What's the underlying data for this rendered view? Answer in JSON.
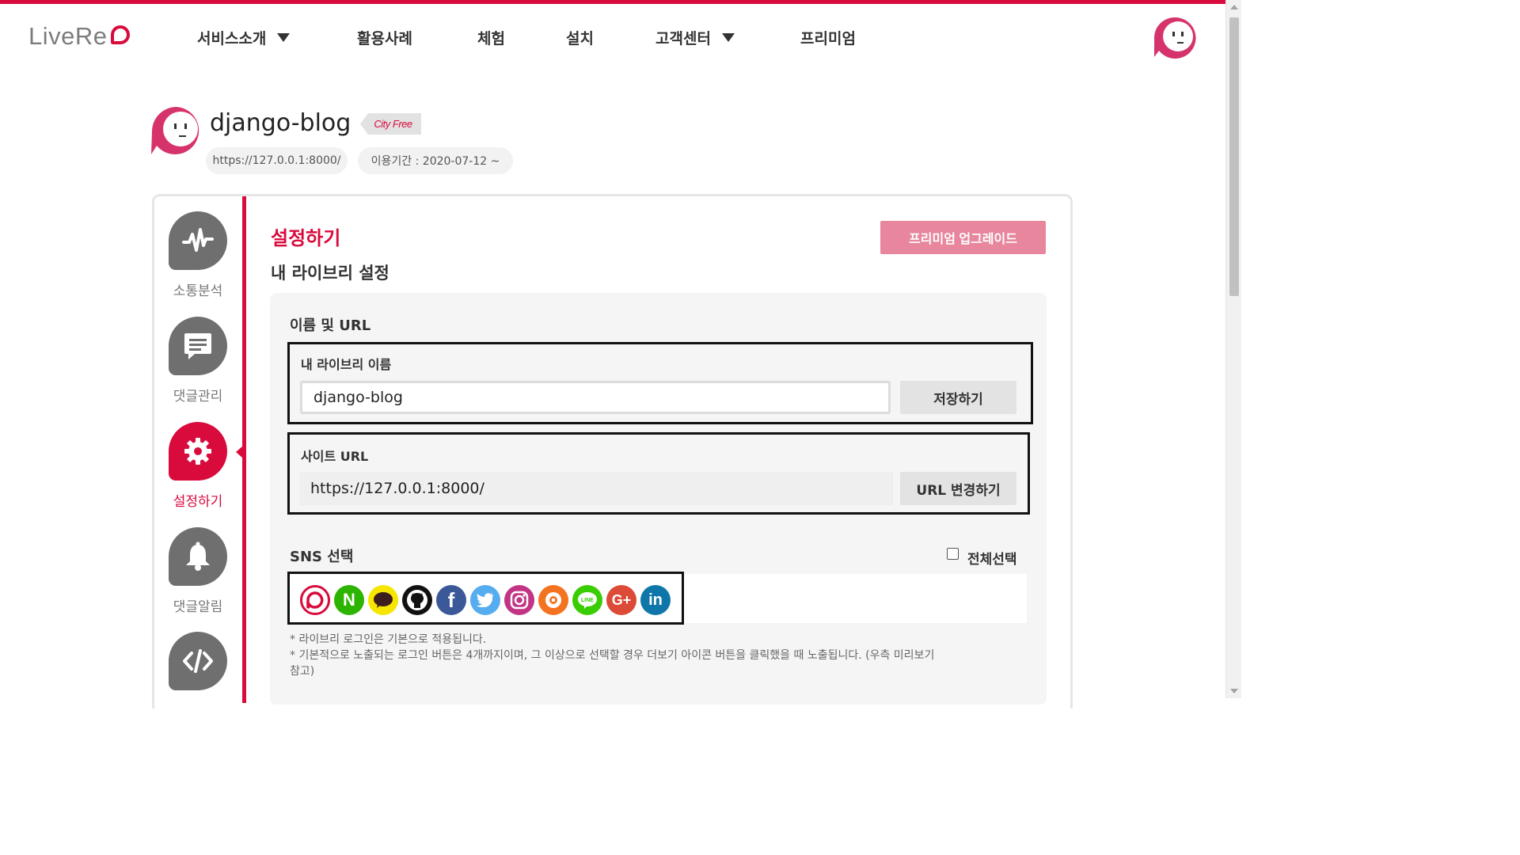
{
  "brand": {
    "logo_text": "LiveRe",
    "accent": "#d90a3c"
  },
  "nav": {
    "items": [
      {
        "label": "서비스소개",
        "dropdown": true
      },
      {
        "label": "활용사례",
        "dropdown": false
      },
      {
        "label": "체험",
        "dropdown": false
      },
      {
        "label": "설치",
        "dropdown": false
      },
      {
        "label": "고객센터",
        "dropdown": true
      },
      {
        "label": "프리미엄",
        "dropdown": false
      }
    ]
  },
  "project": {
    "name": "django-blog",
    "plan_badge": "City Free",
    "url": "https://127.0.0.1:8000/",
    "period": "이용기간 : 2020-07-12 ~"
  },
  "sidebar": {
    "items": [
      {
        "label": "소통분석",
        "icon": "pulse-icon",
        "active": false
      },
      {
        "label": "댓글관리",
        "icon": "comment-icon",
        "active": false
      },
      {
        "label": "설정하기",
        "icon": "gear-icon",
        "active": true
      },
      {
        "label": "댓글알림",
        "icon": "bell-icon",
        "active": false
      },
      {
        "label": "",
        "icon": "code-icon",
        "active": false
      }
    ]
  },
  "main": {
    "section_title": "설정하기",
    "subtitle": "내 라이브리 설정",
    "premium_button": "프리미엄 업그레이드",
    "name_url": {
      "heading": "이름 및 URL",
      "library_name_label": "내 라이브리 이름",
      "library_name_value": "django-blog",
      "save_button": "저장하기",
      "site_url_label": "사이트 URL",
      "site_url_value": "https://127.0.0.1:8000/",
      "change_url_button": "URL 변경하기"
    },
    "sns": {
      "heading": "SNS 선택",
      "select_all_label": "전체선택",
      "select_all_checked": false,
      "providers": [
        {
          "name": "LiveRe",
          "icon": "livere-icon",
          "color": "#d90a3c"
        },
        {
          "name": "Naver",
          "icon": "naver-icon",
          "color": "#2db400"
        },
        {
          "name": "Kakao",
          "icon": "kakao-icon",
          "color": "#f7e600"
        },
        {
          "name": "GitHub",
          "icon": "github-icon",
          "color": "#111111"
        },
        {
          "name": "Facebook",
          "icon": "facebook-icon",
          "color": "#3b5998"
        },
        {
          "name": "Twitter",
          "icon": "twitter-icon",
          "color": "#55acee"
        },
        {
          "name": "Instagram",
          "icon": "instagram-icon",
          "color": "#c13584"
        },
        {
          "name": "Daum",
          "icon": "daum-icon",
          "color": "#f47321"
        },
        {
          "name": "Line",
          "icon": "line-icon",
          "color": "#3acd01"
        },
        {
          "name": "Google+",
          "icon": "google-plus-icon",
          "color": "#dc4a38"
        },
        {
          "name": "LinkedIn",
          "icon": "linkedin-icon",
          "color": "#0e76a8"
        }
      ],
      "note_1": "* 라이브리 로그인은 기본으로 적용됩니다.",
      "note_2": "* 기본적으로 노출되는 로그인 버튼은 4개까지이며, 그 이상으로 선택할 경우 더보기 아이콘 버튼을 클릭했을 때 노출됩니다. (우측 미리보기",
      "note_3": "참고)"
    }
  }
}
